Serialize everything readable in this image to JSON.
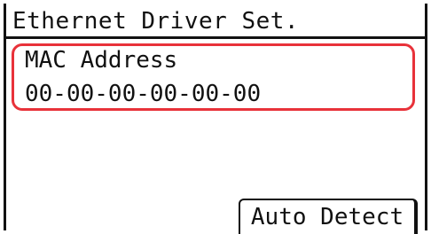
{
  "header": {
    "title": "Ethernet Driver Set."
  },
  "mac": {
    "label": "MAC Address",
    "value": "00-00-00-00-00-00"
  },
  "actions": {
    "auto_detect_label": "Auto Detect"
  },
  "colors": {
    "focus": "#e8323a",
    "foreground": "#111111",
    "background": "#ffffff"
  }
}
